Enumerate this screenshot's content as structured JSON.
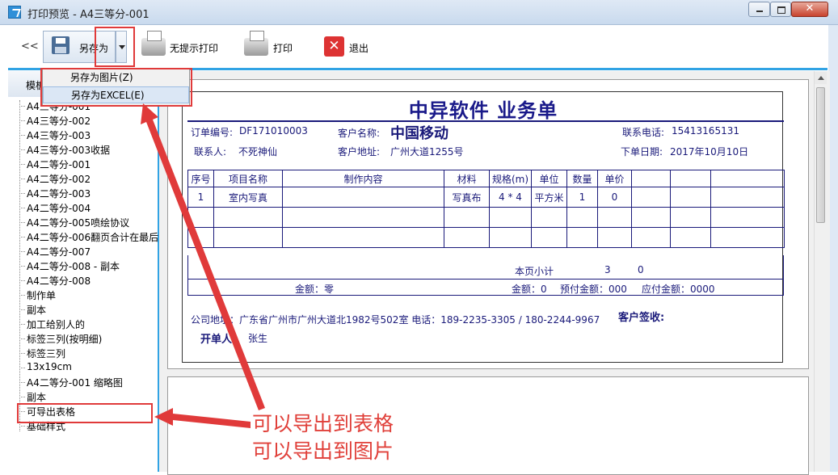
{
  "window": {
    "title": "打印预览 - A4三等分-001"
  },
  "toolbar": {
    "back": "<<",
    "save_as": "另存为",
    "print_silent": "无提示打印",
    "print": "打印",
    "exit": "退出"
  },
  "dropdown": {
    "items": [
      "另存为图片(Z)",
      "另存为EXCEL(E)"
    ]
  },
  "left_panel": {
    "header": "模板",
    "items": [
      "A4三等分-001",
      "A4三等分-002",
      "A4三等分-003",
      "A4三等分-003收据",
      "A4二等分-001",
      "A4二等分-002",
      "A4二等分-003",
      "A4二等分-004",
      "A4二等分-005喷绘协议",
      "A4二等分-006翻页合计在最后",
      "A4二等分-007",
      "A4二等分-008 - 副本",
      "A4二等分-008",
      "制作单",
      "副本",
      "加工给别人的",
      "标签三列(按明细)",
      "标签三列",
      "13x19cm",
      "A4二等分-001 缩略图",
      "副本",
      "可导出表格",
      "基础样式"
    ]
  },
  "document": {
    "title": "中异软件  业务单",
    "order_no_label": "订单编号:",
    "order_no": "DF171010003",
    "customer_label": "客户名称:",
    "customer": "中国移动",
    "phone_label": "联系电话:",
    "phone": "15413165131",
    "contact_label": "联系人:",
    "contact": "不死神仙",
    "address_label": "客户地址:",
    "address": "广州大道1255号",
    "date_label": "下单日期:",
    "date": "2017年10月10日",
    "columns": [
      "序号",
      "项目名称",
      "制作内容",
      "材料",
      "规格(m)",
      "单位",
      "数量",
      "单价"
    ],
    "rows": [
      [
        "1",
        "室内写真",
        "",
        "写真布",
        "4 * 4",
        "平方米",
        "1",
        "0"
      ]
    ],
    "subtotal_label": "本页小计",
    "subtotal_qty": "3",
    "subtotal_price": "0",
    "amount_words": "金额：零",
    "amount": "金额：0",
    "prepaid": "预付金额：000",
    "payable": "应付金额：0000",
    "company_address": "公司地址：广东省广州市广州大道北1982号502室  电话：189-2235-3305 / 180-2244-9967",
    "customer_sign": "客户签收:",
    "issuer_label": "开单人:",
    "issuer": "张生"
  },
  "annotations": {
    "note1": "可以导出到表格",
    "note2": "可以导出到图片",
    "color": "#e03a3a"
  }
}
